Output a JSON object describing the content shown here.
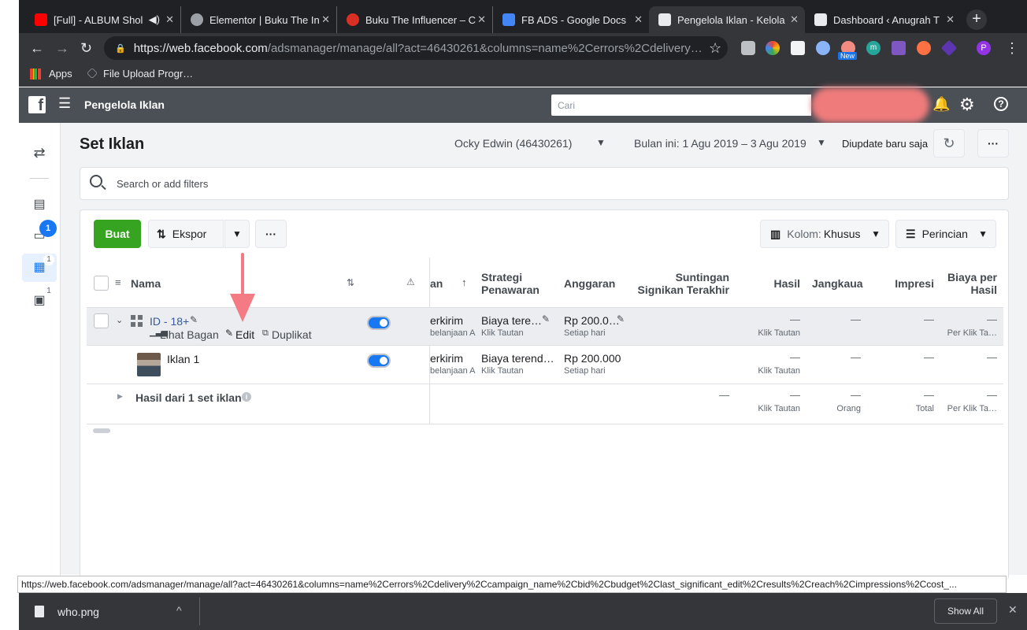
{
  "browser": {
    "tabs": [
      {
        "title": "[Full] - ALBUM Shol",
        "favicon_color": "#ff0000"
      },
      {
        "title": "Elementor | Buku The In",
        "favicon_color": "#9aa0a6"
      },
      {
        "title": "Buku The Influencer – C",
        "favicon_color": "#d93025"
      },
      {
        "title": "FB ADS - Google Docs",
        "favicon_color": "#4285f4"
      },
      {
        "title": "Pengelola Iklan - Kelola",
        "favicon_color": "#e8eaed"
      },
      {
        "title": "Dashboard ‹ Anugrah T",
        "favicon_color": "#e8eaed"
      }
    ],
    "url_host": "https://web.facebook.com",
    "url_path": "/adsmanager/manage/all?act=46430261&columns=name%2Cerrors%2Cdelivery…",
    "ext_new_badge": "New",
    "profile_initial": "P",
    "bookmarks": [
      "Apps",
      "File Upload Progr…"
    ],
    "status_url": "https://web.facebook.com/adsmanager/manage/all?act=46430261&columns=name%2Cerrors%2Cdelivery%2Ccampaign_name%2Cbid%2Cbudget%2Clast_significant_edit%2Cresults%2Creach%2Cimpressions%2Ccost_...",
    "download_file": "who.png",
    "show_all": "Show All"
  },
  "fb": {
    "app_title": "Pengelola Iklan",
    "search_placeholder": "Cari"
  },
  "sidebar": {
    "badge_folder": "1",
    "badge_adsets": "1",
    "badge_ads": "1"
  },
  "page": {
    "title": "Set Iklan",
    "account": "Ocky Edwin (46430261)",
    "date_range": "Bulan ini: 1 Agu 2019 – 3 Agu 2019",
    "updated": "Diupdate baru saja",
    "filter_placeholder": "Search or add filters"
  },
  "actions": {
    "create": "Buat",
    "export": "Ekspor",
    "columns_label": "Kolom:",
    "columns_value": "Khusus",
    "breakdown": "Perincian"
  },
  "table": {
    "headers": {
      "name": "Nama",
      "delivery_partial": "an",
      "bid_l1": "Strategi",
      "bid_l2": "Penawaran",
      "budget": "Anggaran",
      "edit_l1": "Suntingan",
      "edit_l2": "Signikan Terakhir",
      "results": "Hasil",
      "reach": "Jangkaua",
      "impressions": "Impresi",
      "cpr_l1": "Biaya per",
      "cpr_l2": "Hasil"
    },
    "row1": {
      "name": "ID - 18+",
      "act_chart": "Lihat Bagan",
      "act_edit": "Edit",
      "act_dup": "Duplikat",
      "delivery": "erkirim",
      "delivery_sub": "belanjaan A",
      "bid": "Biaya tere…",
      "bid_sub": "Klik Tautan",
      "budget": "Rp 200.0…",
      "budget_sub": "Setiap hari",
      "results": "—",
      "results_sub": "Klik Tautan",
      "reach": "—",
      "impressions": "—",
      "cpr": "—",
      "cpr_sub": "Per Klik Ta…"
    },
    "row2": {
      "name": "Iklan 1",
      "delivery": "erkirim",
      "delivery_sub": "belanjaan A",
      "bid": "Biaya terend…",
      "bid_sub": "Klik Tautan",
      "budget": "Rp 200.000",
      "budget_sub": "Setiap hari",
      "results": "—",
      "results_sub": "Klik Tautan",
      "reach": "—",
      "impressions": "—",
      "cpr": "—"
    },
    "summary": {
      "label": "Hasil dari 1 set iklan",
      "edit": "—",
      "results": "—",
      "results_sub": "Klik Tautan",
      "reach": "—",
      "reach_sub": "Orang",
      "impressions": "—",
      "impressions_sub": "Total",
      "cpr": "—",
      "cpr_sub": "Per Klik Ta…"
    }
  },
  "colors": {
    "fb_header": "#4b4f56",
    "create_green": "#36a420",
    "link_blue": "#385898",
    "toggle_blue": "#1877f2",
    "arrow_pink": "#f47a84"
  }
}
